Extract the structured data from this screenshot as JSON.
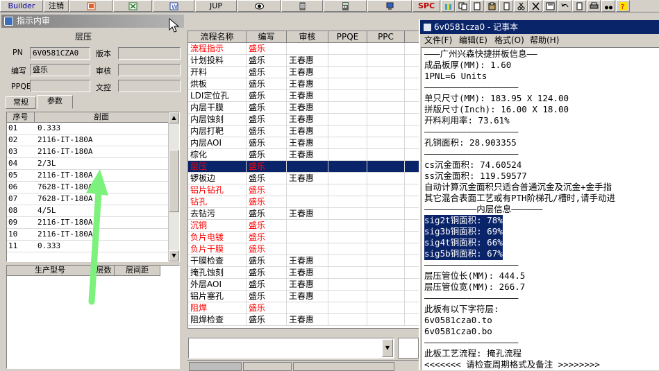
{
  "toolbar": {
    "builder": "Builder",
    "logout": "注销",
    "jup": "JUP",
    "spc": "SPC"
  },
  "left": {
    "title": "指示内审",
    "group_title": "层压",
    "pn_label": "PN",
    "pn_value": "6V0581CZA0",
    "version_label": "版本",
    "version_value": "",
    "author_label": "编写",
    "author_value": "盛乐",
    "review_label": "审核",
    "review_value": "",
    "ppqe_label": "PPQE",
    "ppqe_value": "",
    "wenkong_label": "文控",
    "wenkong_value": "",
    "tabs": [
      "常规",
      "参数"
    ],
    "grid_headers": [
      "序号",
      "剖面"
    ],
    "grid_rows": [
      {
        "no": "01",
        "profile": "0.333"
      },
      {
        "no": "02",
        "profile": "2116-IT-180A"
      },
      {
        "no": "03",
        "profile": "2116-IT-180A"
      },
      {
        "no": "04",
        "profile": "2/3L"
      },
      {
        "no": "05",
        "profile": "2116-IT-180A"
      },
      {
        "no": "06",
        "profile": "7628-IT-180A"
      },
      {
        "no": "07",
        "profile": "7628-IT-180A"
      },
      {
        "no": "08",
        "profile": "4/5L"
      },
      {
        "no": "09",
        "profile": "2116-IT-180A"
      },
      {
        "no": "10",
        "profile": "2116-IT-180A"
      },
      {
        "no": "11",
        "profile": "0.333"
      }
    ],
    "prod_headers": [
      "生产型号",
      "层数",
      "层间距"
    ]
  },
  "middle": {
    "headers": [
      "流程名称",
      "编写",
      "审核",
      "PPQE",
      "PPC",
      ""
    ],
    "rows": [
      {
        "name": "流程指示",
        "author": "盛乐",
        "reviewer": "",
        "status": "red"
      },
      {
        "name": "计划投料",
        "author": "盛乐",
        "reviewer": "王春惠",
        "status": "normal"
      },
      {
        "name": "开料",
        "author": "盛乐",
        "reviewer": "王春惠",
        "status": "normal"
      },
      {
        "name": "烘板",
        "author": "盛乐",
        "reviewer": "王春惠",
        "status": "normal"
      },
      {
        "name": "LDI定位孔",
        "author": "盛乐",
        "reviewer": "王春惠",
        "status": "normal"
      },
      {
        "name": "内层干膜",
        "author": "盛乐",
        "reviewer": "王春惠",
        "status": "normal"
      },
      {
        "name": "内层蚀刻",
        "author": "盛乐",
        "reviewer": "王春惠",
        "status": "normal"
      },
      {
        "name": "内层打靶",
        "author": "盛乐",
        "reviewer": "王春惠",
        "status": "normal"
      },
      {
        "name": "内层AOI",
        "author": "盛乐",
        "reviewer": "王春惠",
        "status": "normal"
      },
      {
        "name": "棕化",
        "author": "盛乐",
        "reviewer": "王春惠",
        "status": "normal"
      },
      {
        "name": "层压",
        "author": "盛乐",
        "reviewer": "",
        "status": "selected"
      },
      {
        "name": "锣板边",
        "author": "盛乐",
        "reviewer": "王春惠",
        "status": "normal"
      },
      {
        "name": "铝片钻孔",
        "author": "盛乐",
        "reviewer": "",
        "status": "red"
      },
      {
        "name": "钻孔",
        "author": "盛乐",
        "reviewer": "",
        "status": "red"
      },
      {
        "name": "去钻污",
        "author": "盛乐",
        "reviewer": "王春惠",
        "status": "normal"
      },
      {
        "name": "沉铜",
        "author": "盛乐",
        "reviewer": "",
        "status": "red"
      },
      {
        "name": "负片电镀",
        "author": "盛乐",
        "reviewer": "",
        "status": "red"
      },
      {
        "name": "负片干膜",
        "author": "盛乐",
        "reviewer": "",
        "status": "red"
      },
      {
        "name": "干膜检查",
        "author": "盛乐",
        "reviewer": "王春惠",
        "status": "normal"
      },
      {
        "name": "掩孔蚀刻",
        "author": "盛乐",
        "reviewer": "王春惠",
        "status": "normal"
      },
      {
        "name": "外层AOI",
        "author": "盛乐",
        "reviewer": "王春惠",
        "status": "normal"
      },
      {
        "name": "铝片塞孔",
        "author": "盛乐",
        "reviewer": "王春惠",
        "status": "normal"
      },
      {
        "name": "阻焊",
        "author": "盛乐",
        "reviewer": "",
        "status": "red"
      },
      {
        "name": "阻焊检查",
        "author": "盛乐",
        "reviewer": "王春惠",
        "status": "normal"
      }
    ]
  },
  "notepad": {
    "title": "6v0581cza0 - 记事本",
    "menu": [
      "文件(F)",
      "编辑(E)",
      "格式(O)",
      "帮助(H)"
    ],
    "lines": [
      {
        "text": "———广州兴森快捷拼板信息——",
        "hl": false
      },
      {
        "text": "成品板厚(MM): 1.60",
        "hl": false
      },
      {
        "text": "1PNL=6 Units",
        "hl": false
      },
      {
        "text": "——————————————————",
        "hl": false
      },
      {
        "text": "单只尺寸(MM): 183.95 X 124.00",
        "hl": false
      },
      {
        "text": "拼版尺寸(Inch): 16.00 X 18.00",
        "hl": false
      },
      {
        "text": "开料利用率: 73.61%",
        "hl": false
      },
      {
        "text": "——————————————————",
        "hl": false
      },
      {
        "text": "孔铜面积: 28.903355",
        "hl": false
      },
      {
        "text": "——————————————————",
        "hl": false
      },
      {
        "text": "cs沉金面积: 74.60524",
        "hl": false
      },
      {
        "text": "ss沉金面积: 119.59577",
        "hl": false
      },
      {
        "text": "自动计算沉金面积只适合普通沉金及沉金+金手指",
        "hl": false
      },
      {
        "text": "其它混合表面工艺或有PTH阶梯孔/槽时,请手动进",
        "hl": false
      },
      {
        "text": "——————————内层信息——————",
        "hl": false
      },
      {
        "text": "sig2t铜面积: 78%",
        "hl": true
      },
      {
        "text": "sig3b铜面积: 69%",
        "hl": true
      },
      {
        "text": "sig4t铜面积: 66%",
        "hl": true
      },
      {
        "text": "sig5b铜面积: 67%",
        "hl": true
      },
      {
        "text": "——————————————————",
        "hl": false
      },
      {
        "text": "层压管位长(MM): 444.5",
        "hl": false
      },
      {
        "text": "层压管位宽(MM): 266.7",
        "hl": false
      },
      {
        "text": "——————————————————",
        "hl": false
      },
      {
        "text": "此板有以下字符层:",
        "hl": false
      },
      {
        "text": "6v0581cza0.to",
        "hl": false
      },
      {
        "text": "6v0581cza0.bo",
        "hl": false
      },
      {
        "text": "——————————————————",
        "hl": false
      },
      {
        "text": "此板工艺流程: 掩孔流程",
        "hl": false
      },
      {
        "text": "<<<<<<< 请检查周期格式及备注 >>>>>>>>",
        "hl": false
      }
    ]
  },
  "colors": {
    "selected_row": "#0a246a",
    "red_text": "#ff0000",
    "arrow": "#7cf27c"
  }
}
